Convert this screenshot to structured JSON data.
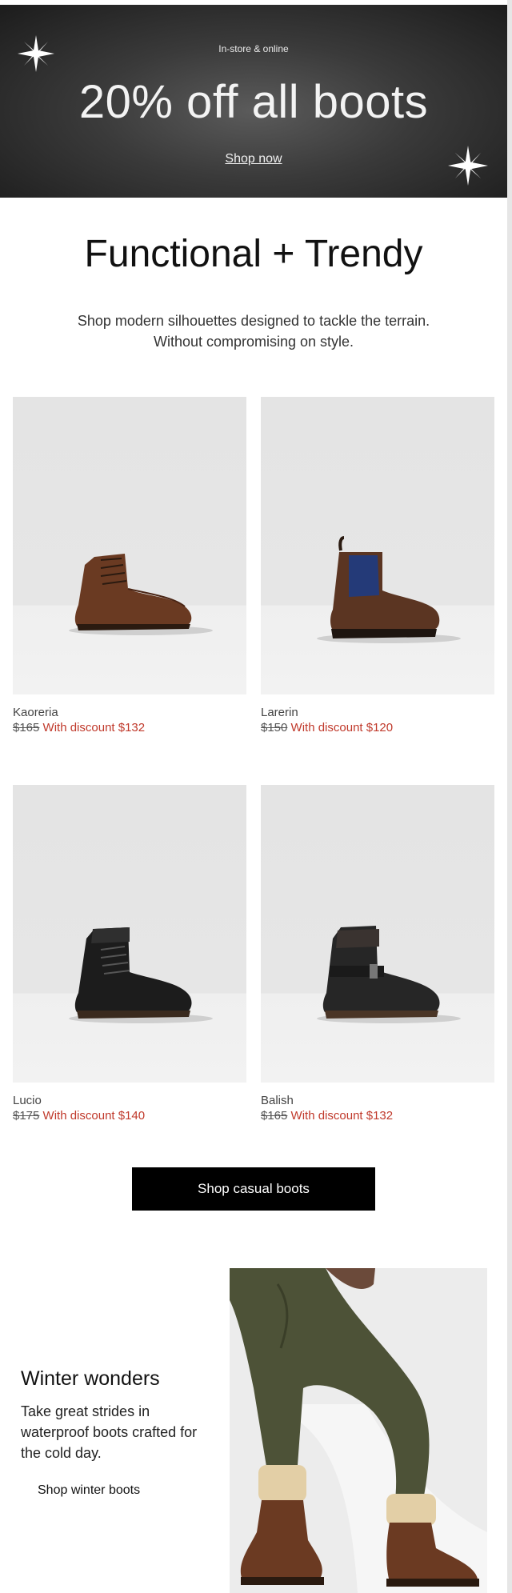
{
  "banner": {
    "eyebrow": "In-store & online",
    "headline": "20% off all boots",
    "link_label": "Shop now",
    "background_color": "#2a2a2a"
  },
  "intro": {
    "title": "Functional + Trendy",
    "subtitle_line1": "Shop modern silhouettes designed to tackle the terrain.",
    "subtitle_line2": "Without compromising on style."
  },
  "products": [
    {
      "name": "Kaoreria",
      "original_price": "$165",
      "discount_label": "With discount $132",
      "boot_color": "#6a3a22"
    },
    {
      "name": "Larerin",
      "original_price": "$150",
      "discount_label": "With discount $120",
      "boot_color": "#5b3522"
    },
    {
      "name": "Lucio",
      "original_price": "$175",
      "discount_label": "With discount $140",
      "boot_color": "#1c1c1c"
    },
    {
      "name": "Balish",
      "original_price": "$165",
      "discount_label": "With discount $132",
      "boot_color": "#262626"
    }
  ],
  "cta": {
    "label": "Shop casual boots"
  },
  "winter": {
    "title": "Winter wonders",
    "text": "Take great strides in waterproof boots crafted for the cold day.",
    "link_label": "Shop winter boots"
  },
  "colors": {
    "discount_red": "#c0392b",
    "cta_black": "#000000"
  }
}
